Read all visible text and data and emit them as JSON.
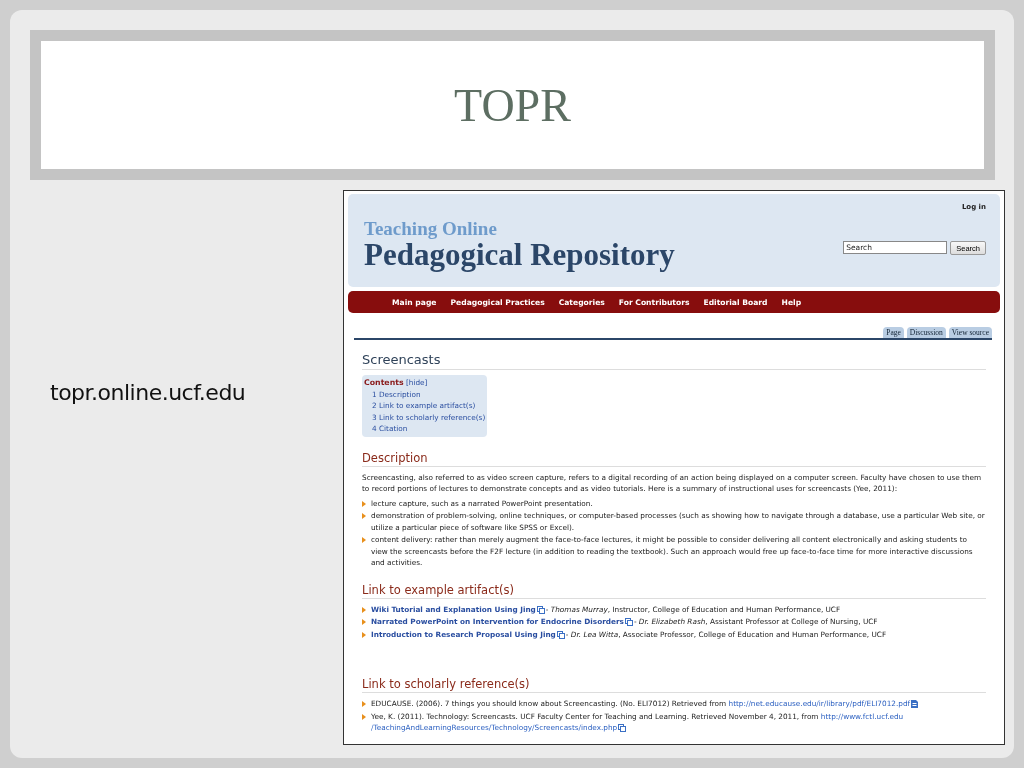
{
  "slide": {
    "title": "TOPR",
    "caption": "topr.online.ucf.edu"
  },
  "page": {
    "header": {
      "login": "Log in",
      "logo_small": "Teaching Online",
      "logo_large": "Pedagogical Repository",
      "search": {
        "placeholder": "Search"
      },
      "search_button": "Search"
    },
    "nav": [
      "Main page",
      "Pedagogical Practices",
      "Categories",
      "For Contributors",
      "Editorial Board",
      "Help"
    ],
    "tabs": [
      "Page",
      "Discussion",
      "View source"
    ],
    "title": "Screencasts",
    "toc": {
      "title": "Contents",
      "toggle": "[hide]",
      "items": [
        "1 Description",
        "2 Link to example artifact(s)",
        "3 Link to scholarly reference(s)",
        "4 Citation"
      ]
    },
    "description": {
      "heading": "Description",
      "text": "Screencasting, also referred to as video screen capture, refers to a digital recording of an action being displayed on a computer screen. Faculty have chosen to use them to record portions of lectures to demonstrate concepts and as video tutorials. Here is a summary of instructional uses for screencasts (Yee, 2011):",
      "bullets": [
        "lecture capture, such as a narrated PowerPoint presentation.",
        "demonstration of problem-solving, online techniques, or computer-based processes (such as showing how to navigate through a database, use a particular Web site, or utilize a particular piece of software like SPSS or Excel).",
        "content delivery: rather than merely augment the face-to-face lectures, it might be possible to consider delivering all content electronically and asking students to view the screencasts before the F2F lecture (in addition to reading the textbook). Such an approach would free up face-to-face time for more interactive discussions and activities."
      ]
    },
    "artifacts": {
      "heading": "Link to example artifact(s)",
      "items": [
        {
          "link": "Wiki Tutorial and Explanation Using Jing",
          "text": "- *Thomas Murray*, Instructor, College of Education and Human Performance, UCF"
        },
        {
          "link": "Narrated PowerPoint on Intervention for Endocrine Disorders",
          "text": "- *Dr. Elizabeth Rash*, Assistant Professor at College of Nursing, UCF"
        },
        {
          "link": "Introduction to Research Proposal Using Jing",
          "text": "- *Dr. Lea Witta*, Associate Professor, College of Education and Human Performance, UCF"
        }
      ]
    },
    "references": {
      "heading": "Link to scholarly reference(s)",
      "items": [
        {
          "text": "EDUCAUSE. (2006). 7 things you should know about Screencasting. (No. ELI7012) Retrieved from",
          "url": [
            "http://net.educause.edu/ir/library/pdf/ELI7012.pdf"
          ],
          "kind": "pdf"
        },
        {
          "text": "Yee, K. (2011). Technology: Screencasts. UCF Faculty Center for Teaching and Learning. Retrieved November 4, 2011, from",
          "url": [
            "http://www.fctl.ucf.edu",
            "/TeachingAndLearningResources/Technology/Screencasts/index.php"
          ],
          "kind": "external"
        }
      ]
    }
  }
}
